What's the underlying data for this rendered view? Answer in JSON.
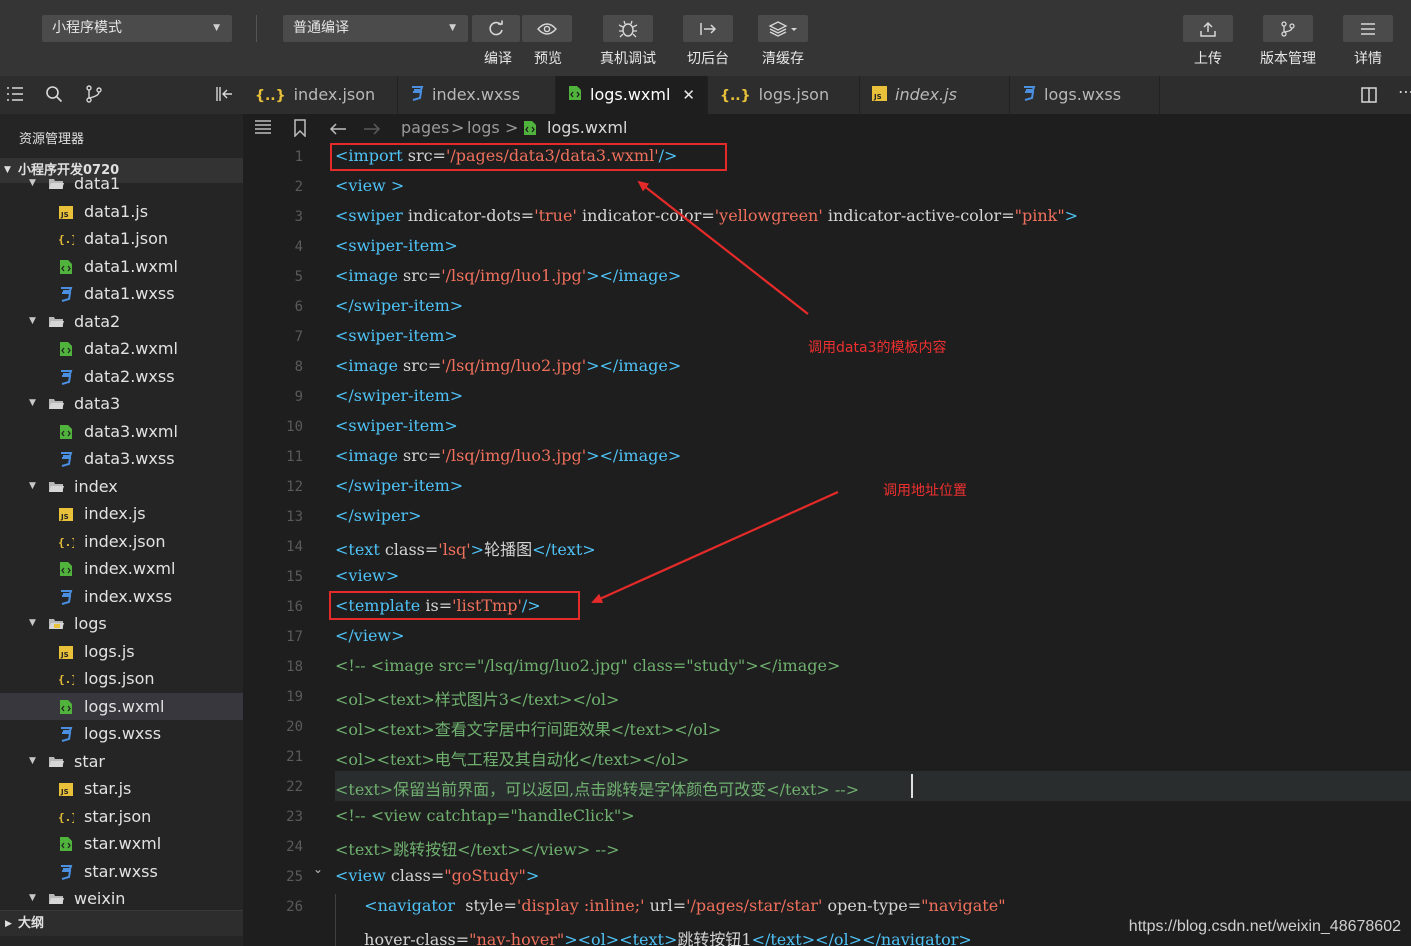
{
  "toolbar": {
    "mode_select": "小程序模式",
    "compile_select": "普通编译",
    "compile_label": "编译",
    "preview_label": "预览",
    "device_debug_label": "真机调试",
    "background_label": "切后台",
    "clear_cache_label": "清缓存",
    "upload_label": "上传",
    "version_label": "版本管理",
    "details_label": "详情"
  },
  "tabs": [
    {
      "label": "index.json",
      "type": "json"
    },
    {
      "label": "index.wxss",
      "type": "wxss"
    },
    {
      "label": "logs.wxml",
      "type": "wxml",
      "close": "✕"
    },
    {
      "label": "logs.json",
      "type": "json"
    },
    {
      "label": "index.js",
      "type": "js"
    },
    {
      "label": "logs.wxss",
      "type": "wxss"
    }
  ],
  "sidebar": {
    "title": "资源管理器",
    "project": "小程序开发0720",
    "outline": "大纲",
    "items": [
      {
        "label": "data1",
        "kind": "folder",
        "level": 1
      },
      {
        "label": "data1.js",
        "kind": "js",
        "level": 2
      },
      {
        "label": "data1.json",
        "kind": "json",
        "level": 2
      },
      {
        "label": "data1.wxml",
        "kind": "wxml",
        "level": 2
      },
      {
        "label": "data1.wxss",
        "kind": "wxss",
        "level": 2
      },
      {
        "label": "data2",
        "kind": "folder",
        "level": 1
      },
      {
        "label": "data2.wxml",
        "kind": "wxml",
        "level": 2
      },
      {
        "label": "data2.wxss",
        "kind": "wxss",
        "level": 2
      },
      {
        "label": "data3",
        "kind": "folder",
        "level": 1
      },
      {
        "label": "data3.wxml",
        "kind": "wxml",
        "level": 2
      },
      {
        "label": "data3.wxss",
        "kind": "wxss",
        "level": 2
      },
      {
        "label": "index",
        "kind": "folder",
        "level": 1
      },
      {
        "label": "index.js",
        "kind": "js",
        "level": 2
      },
      {
        "label": "index.json",
        "kind": "json",
        "level": 2
      },
      {
        "label": "index.wxml",
        "kind": "wxml",
        "level": 2
      },
      {
        "label": "index.wxss",
        "kind": "wxss",
        "level": 2
      },
      {
        "label": "logs",
        "kind": "folder-special",
        "level": 1
      },
      {
        "label": "logs.js",
        "kind": "js",
        "level": 2
      },
      {
        "label": "logs.json",
        "kind": "json",
        "level": 2
      },
      {
        "label": "logs.wxml",
        "kind": "wxml",
        "level": 2,
        "selected": true
      },
      {
        "label": "logs.wxss",
        "kind": "wxss",
        "level": 2
      },
      {
        "label": "star",
        "kind": "folder",
        "level": 1
      },
      {
        "label": "star.js",
        "kind": "js",
        "level": 2
      },
      {
        "label": "star.json",
        "kind": "json",
        "level": 2
      },
      {
        "label": "star.wxml",
        "kind": "wxml",
        "level": 2
      },
      {
        "label": "star.wxss",
        "kind": "wxss",
        "level": 2
      },
      {
        "label": "weixin",
        "kind": "folder",
        "level": 1
      }
    ]
  },
  "breadcrumb": {
    "parts": [
      "pages",
      "logs",
      "logs.wxml"
    ]
  },
  "code_lines": [
    {
      "n": "1",
      "tokens": [
        [
          "tag",
          "<import "
        ],
        [
          "attr",
          "src="
        ],
        [
          "str",
          "'/pages/data3/data3.wxml'"
        ],
        [
          "tag",
          "/>"
        ]
      ]
    },
    {
      "n": "2",
      "tokens": [
        [
          "tag",
          "<view >"
        ]
      ]
    },
    {
      "n": "3",
      "tokens": [
        [
          "tag",
          "<swiper "
        ],
        [
          "attr",
          "indicator-dots="
        ],
        [
          "str",
          "'true'"
        ],
        [
          "attr",
          " indicator-color="
        ],
        [
          "str",
          "'yellowgreen'"
        ],
        [
          "attr",
          " indicator-active-color="
        ],
        [
          "str",
          "\"pink\""
        ],
        [
          "tag",
          ">"
        ]
      ]
    },
    {
      "n": "4",
      "tokens": [
        [
          "tag",
          "<swiper-item>"
        ]
      ]
    },
    {
      "n": "5",
      "tokens": [
        [
          "tag",
          "<image "
        ],
        [
          "attr",
          "src="
        ],
        [
          "str",
          "'/lsq/img/luo1.jpg'"
        ],
        [
          "tag",
          "></image>"
        ]
      ]
    },
    {
      "n": "6",
      "tokens": [
        [
          "tag",
          "</swiper-item>"
        ]
      ]
    },
    {
      "n": "7",
      "tokens": [
        [
          "tag",
          "<swiper-item>"
        ]
      ]
    },
    {
      "n": "8",
      "tokens": [
        [
          "tag",
          "<image "
        ],
        [
          "attr",
          "src="
        ],
        [
          "str",
          "'/lsq/img/luo2.jpg'"
        ],
        [
          "tag",
          "></image>"
        ]
      ]
    },
    {
      "n": "9",
      "tokens": [
        [
          "tag",
          "</swiper-item>"
        ]
      ]
    },
    {
      "n": "10",
      "tokens": [
        [
          "tag",
          "<swiper-item>"
        ]
      ]
    },
    {
      "n": "11",
      "tokens": [
        [
          "tag",
          "<image "
        ],
        [
          "attr",
          "src="
        ],
        [
          "str",
          "'/lsq/img/luo3.jpg'"
        ],
        [
          "tag",
          "></image>"
        ]
      ]
    },
    {
      "n": "12",
      "tokens": [
        [
          "tag",
          "</swiper-item>"
        ]
      ]
    },
    {
      "n": "13",
      "tokens": [
        [
          "tag",
          "</swiper>"
        ]
      ]
    },
    {
      "n": "14",
      "tokens": [
        [
          "tag",
          "<text "
        ],
        [
          "attr",
          "class="
        ],
        [
          "str",
          "'lsq'"
        ],
        [
          "tag",
          ">"
        ],
        [
          "txt",
          "轮播图"
        ],
        [
          "tag",
          "</text>"
        ]
      ]
    },
    {
      "n": "15",
      "tokens": [
        [
          "tag",
          "<view>"
        ]
      ]
    },
    {
      "n": "16",
      "tokens": [
        [
          "tag",
          "<template "
        ],
        [
          "attr",
          "is="
        ],
        [
          "str",
          "'listTmp'"
        ],
        [
          "tag",
          "/>"
        ]
      ]
    },
    {
      "n": "17",
      "tokens": [
        [
          "tag",
          "</view>"
        ]
      ]
    },
    {
      "n": "18",
      "tokens": [
        [
          "cmt",
          "<!-- <image src=\"/lsq/img/luo2.jpg\" class=\"study\"></image>"
        ]
      ]
    },
    {
      "n": "19",
      "tokens": [
        [
          "cmt",
          "<ol><text>样式图片3</text></ol>"
        ]
      ]
    },
    {
      "n": "20",
      "tokens": [
        [
          "cmt",
          "<ol><text>查看文字居中行间距效果</text></ol>"
        ]
      ]
    },
    {
      "n": "21",
      "tokens": [
        [
          "cmt",
          "<ol><text>电气工程及其自动化</text></ol>"
        ]
      ]
    },
    {
      "n": "22",
      "tokens": [
        [
          "cmt",
          "<text>保留当前界面，可以返回,点击跳转是字体颜色可改变</text> -->"
        ]
      ]
    },
    {
      "n": "23",
      "tokens": [
        [
          "cmt",
          "<!-- <view catchtap=\"handleClick\">"
        ]
      ]
    },
    {
      "n": "24",
      "tokens": [
        [
          "cmt",
          "<text>跳转按钮</text></view> -->"
        ]
      ]
    },
    {
      "n": "25",
      "tokens": [
        [
          "tag",
          "<view "
        ],
        [
          "attr",
          "class="
        ],
        [
          "str",
          "\"goStudy\""
        ],
        [
          "tag",
          ">"
        ]
      ]
    },
    {
      "n": "26",
      "tokens": [
        [
          "tag",
          "  <navigator  "
        ],
        [
          "attr",
          "style="
        ],
        [
          "str",
          "'display :inline;'"
        ],
        [
          "attr",
          " url="
        ],
        [
          "str",
          "'/pages/star/star'"
        ],
        [
          "attr",
          " open-type="
        ],
        [
          "str",
          "\"navigate\""
        ]
      ]
    },
    {
      "n": "",
      "tokens": [
        [
          "attr",
          "  hover-class="
        ],
        [
          "str",
          "\"nav-hover\""
        ],
        [
          "tag",
          ">"
        ],
        [
          "tag",
          "<ol><text>"
        ],
        [
          "txt",
          "跳转按钮1"
        ],
        [
          "tag",
          "</text></ol></navigator>"
        ]
      ]
    }
  ],
  "annotations": {
    "note_template": "调用data3的模板内容",
    "note_address": "调用地址位置"
  },
  "watermark": "https://blog.csdn.net/weixin_48678602",
  "colors": {
    "tag": "#4fc3f7",
    "string": "#f0705c",
    "comment": "#6fb06f",
    "annotation": "#e52a2a"
  }
}
